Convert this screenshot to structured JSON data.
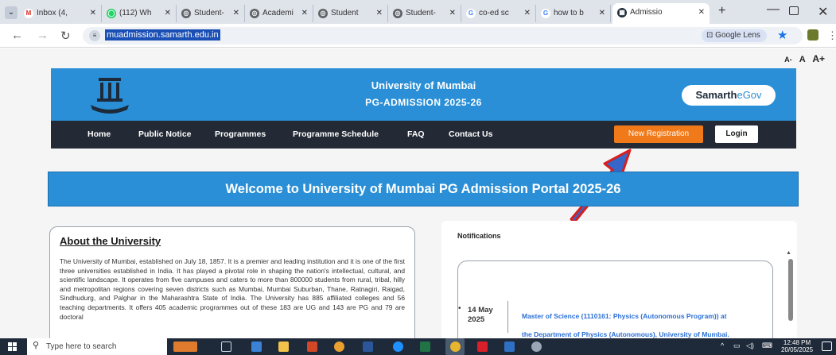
{
  "browser": {
    "tabs": [
      {
        "label": "Inbox (4,",
        "favicon": "gmail-icon",
        "color": "#d93025"
      },
      {
        "label": "(112) Wh",
        "favicon": "whatsapp-icon",
        "color": "#25d366"
      },
      {
        "label": "Student-",
        "favicon": "site-icon",
        "color": "#5f6368"
      },
      {
        "label": "Academi",
        "favicon": "site-icon",
        "color": "#5f6368"
      },
      {
        "label": "Student",
        "favicon": "site-icon",
        "color": "#5f6368"
      },
      {
        "label": "Student-",
        "favicon": "site-icon",
        "color": "#5f6368"
      },
      {
        "label": "co-ed sc",
        "favicon": "google-icon",
        "color": "#4285f4"
      },
      {
        "label": "how to b",
        "favicon": "google-icon",
        "color": "#4285f4"
      },
      {
        "label": "Admissio",
        "favicon": "university-icon",
        "color": "#1d2a3a",
        "active": true
      }
    ],
    "url": "muadmission.samarth.edu.in",
    "lens_label": "Google Lens"
  },
  "page": {
    "font_sizes": [
      "A-",
      "A",
      "A+"
    ],
    "banner": {
      "title": "University of Mumbai",
      "subtitle": "PG-ADMISSION 2025-26",
      "brand_main": "Samarth",
      "brand_sub": "eGov"
    },
    "nav": {
      "items": [
        "Home",
        "Public Notice",
        "Programmes",
        "Programme Schedule",
        "FAQ",
        "Contact Us"
      ],
      "new_registration": "New Registration",
      "login": "Login"
    },
    "welcome": "Welcome to University of Mumbai PG Admission Portal 2025-26",
    "about": {
      "title": "About the University",
      "text": "The University of Mumbai, established on July 18, 1857. It is a premier and leading institution and it is one of the first three universities established in India. It has played a pivotal role in shaping the nation's intellectual, cultural, and scientific landscape. It operates from five campuses and caters to more than 800000 students from rural, tribal, hilly and metropolitan regions covering seven districts such as Mumbai, Mumbai Suburban, Thane, Ratnagiri, Raigad, Sindhudurg, and Palghar in the Maharashtra State of India. The University has 885 affiliated colleges and 56 teaching departments. It offers 405 academic programmes out of these 183 are UG and 143 are PG and 79 are doctoral"
    },
    "notifications": {
      "title": "Notifications",
      "items": [
        {
          "date": "14 May 2025",
          "text": "Master of Science (1110161: Physics (Autonomous Program)) at",
          "text2": "the Department of Physics (Autonomous), University of Mumbai."
        }
      ]
    }
  },
  "taskbar": {
    "search_placeholder": "Type here to search",
    "time": "12:48 PM",
    "date": "20/05/2025"
  }
}
